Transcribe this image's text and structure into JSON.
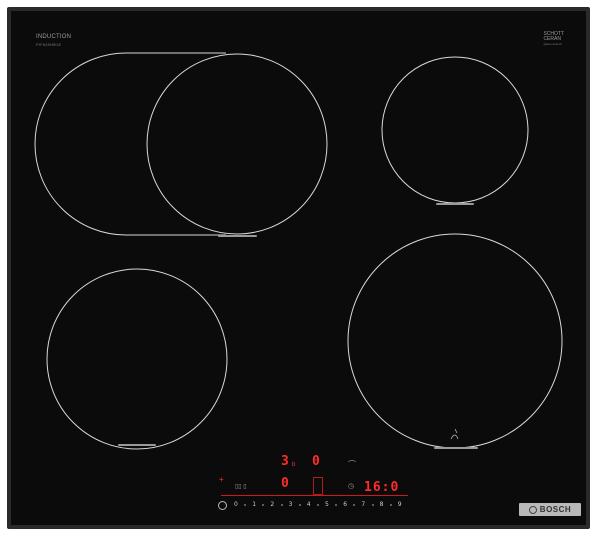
{
  "brand_top_left": {
    "title": "INDUCTION",
    "subtitle": "PIF645HB1E"
  },
  "brand_top_right": {
    "line1": "SCHOTT",
    "line2": "CERAN",
    "subtitle": "glass-ceramic"
  },
  "displays": {
    "zone_front_left": "3",
    "zone_front_left_sub": "b",
    "zone_front_right": "0",
    "zone_rear_left": "0",
    "timer": "16:0",
    "plus_label": "+"
  },
  "scale": [
    "0",
    "1",
    "2",
    "3",
    "4",
    "5",
    "6",
    "7",
    "8",
    "9"
  ],
  "badge": {
    "text": "BOSCH"
  },
  "icons": [
    "power-icon",
    "timer-icon",
    "plus-icon",
    "frying-sensor-icon",
    "pan-icon",
    "cooking-zone-icon"
  ],
  "colors": {
    "glass": "#0b0b0b",
    "frame": "#2a2a2a",
    "ring": "#d9d9d9",
    "display": "#ff2b2b",
    "accent_line": "#cc1a1a"
  }
}
